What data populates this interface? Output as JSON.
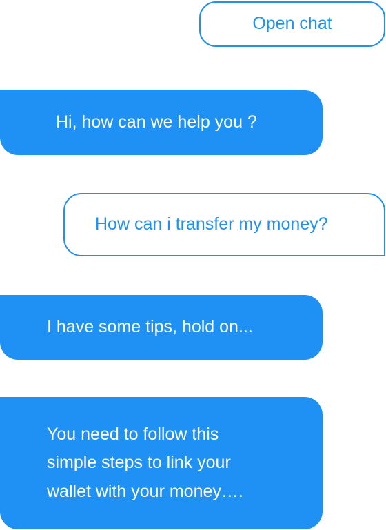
{
  "chat": {
    "open_chat_label": "Open chat",
    "messages": [
      {
        "from": "agent",
        "text": "Hi, how can we help you ?"
      },
      {
        "from": "user",
        "text": "How can i transfer my money?"
      },
      {
        "from": "agent",
        "text": "I have some tips, hold on..."
      },
      {
        "from": "agent",
        "text": "You need to follow this\nsimple steps to link your\nwallet with your money…."
      }
    ]
  },
  "colors": {
    "accent": "#1f91f5",
    "background": "#ffffff",
    "incoming_text": "#ffffff"
  }
}
